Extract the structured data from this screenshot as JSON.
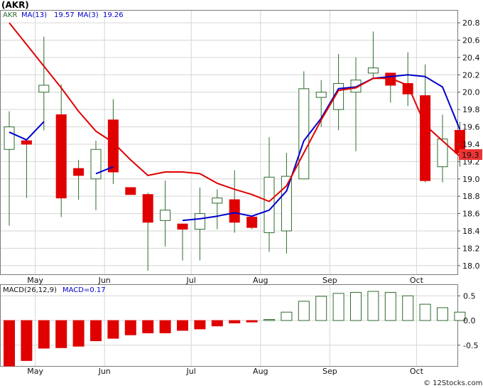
{
  "chart_data": {
    "type": "candlestick",
    "ticker_label": "(AKR)",
    "legend": {
      "ticker": "AKR",
      "ma_long_label": "MA(13)",
      "ma_long_value": "19.57",
      "ma_short_label": "MA(3)",
      "ma_short_value": "19.26"
    },
    "colors": {
      "up_fill": "#ffffff",
      "up_border": "#2e6b2e",
      "down_fill": "#e00000",
      "wick": "#2e6b2e",
      "ma_long": "#0000cc",
      "ma_short": "#e00000",
      "macd_pos_border": "#2e6b2e",
      "macd_neg_fill": "#e00000",
      "grid": "#d6d6d6",
      "panel_bg": "#ffffff",
      "current_price_box": "#ee3333"
    },
    "price_axis": {
      "ylim": [
        17.9,
        20.94
      ],
      "ticks": [
        "20.8",
        "20.6",
        "20.4",
        "20.2",
        "20.0",
        "19.8",
        "19.6",
        "19.4",
        "19.2",
        "19.0",
        "18.8",
        "18.6",
        "18.4",
        "18.2",
        "18.0"
      ],
      "current_price": "19.3"
    },
    "months": [
      "May",
      "Jun",
      "Jul",
      "Aug",
      "Sep",
      "Oct"
    ],
    "month_positions": [
      1.5,
      5.5,
      10.5,
      14.5,
      18.5,
      23.5
    ],
    "candles": [
      {
        "o": 19.34,
        "h": 19.78,
        "l": 18.46,
        "c": 19.6
      },
      {
        "o": 19.44,
        "h": 19.44,
        "l": 18.78,
        "c": 19.4
      },
      {
        "o": 20.0,
        "h": 20.64,
        "l": 19.56,
        "c": 20.08
      },
      {
        "o": 19.74,
        "h": 20.09,
        "l": 18.56,
        "c": 18.78
      },
      {
        "o": 19.12,
        "h": 19.22,
        "l": 18.76,
        "c": 19.04
      },
      {
        "o": 19.0,
        "h": 19.44,
        "l": 18.64,
        "c": 19.34
      },
      {
        "o": 19.68,
        "h": 19.92,
        "l": 18.94,
        "c": 19.08
      },
      {
        "o": 18.9,
        "h": 18.9,
        "l": 18.82,
        "c": 18.82
      },
      {
        "o": 18.82,
        "h": 18.84,
        "l": 17.94,
        "c": 18.5
      },
      {
        "o": 18.52,
        "h": 18.98,
        "l": 18.22,
        "c": 18.64
      },
      {
        "o": 18.48,
        "h": 18.48,
        "l": 18.06,
        "c": 18.42
      },
      {
        "o": 18.42,
        "h": 18.9,
        "l": 18.06,
        "c": 18.6
      },
      {
        "o": 18.72,
        "h": 18.88,
        "l": 18.42,
        "c": 18.78
      },
      {
        "o": 18.76,
        "h": 19.1,
        "l": 18.38,
        "c": 18.5
      },
      {
        "o": 18.56,
        "h": 18.56,
        "l": 18.42,
        "c": 18.44
      },
      {
        "o": 18.38,
        "h": 19.48,
        "l": 18.16,
        "c": 19.02
      },
      {
        "o": 18.4,
        "h": 19.3,
        "l": 18.14,
        "c": 19.03
      },
      {
        "o": 19.0,
        "h": 20.24,
        "l": 19.0,
        "c": 20.04
      },
      {
        "o": 19.94,
        "h": 20.14,
        "l": 19.6,
        "c": 20.0
      },
      {
        "o": 19.8,
        "h": 20.44,
        "l": 19.56,
        "c": 20.1
      },
      {
        "o": 20.0,
        "h": 20.4,
        "l": 19.32,
        "c": 20.14
      },
      {
        "o": 20.22,
        "h": 20.7,
        "l": 20.16,
        "c": 20.28
      },
      {
        "o": 20.22,
        "h": 20.22,
        "l": 19.88,
        "c": 20.08
      },
      {
        "o": 20.1,
        "h": 20.46,
        "l": 19.84,
        "c": 19.98
      },
      {
        "o": 19.96,
        "h": 20.32,
        "l": 18.96,
        "c": 18.98
      },
      {
        "o": 19.14,
        "h": 19.74,
        "l": 18.96,
        "c": 19.46
      },
      {
        "o": 19.56,
        "h": 19.66,
        "l": 19.14,
        "c": 19.3
      }
    ],
    "ma_short": [
      [
        0,
        20.8
      ],
      [
        1,
        20.55
      ],
      [
        2,
        20.3
      ],
      [
        3,
        20.05
      ],
      [
        4,
        19.78
      ],
      [
        5,
        19.55
      ],
      [
        6,
        19.42
      ],
      [
        7,
        19.22
      ],
      [
        8,
        19.04
      ],
      [
        9,
        19.08
      ],
      [
        10,
        19.08
      ],
      [
        11,
        19.06
      ],
      [
        12,
        18.95
      ],
      [
        13,
        18.88
      ],
      [
        14,
        18.82
      ],
      [
        15,
        18.74
      ],
      [
        16,
        18.92
      ],
      [
        17,
        19.3
      ],
      [
        18,
        19.68
      ],
      [
        19,
        20.02
      ],
      [
        20,
        20.05
      ],
      [
        21,
        20.16
      ],
      [
        22,
        20.16
      ],
      [
        23,
        20.08
      ],
      [
        24,
        19.62
      ],
      [
        25,
        19.44
      ],
      [
        26,
        19.26
      ]
    ],
    "ma_long": [
      [
        0,
        19.54
      ],
      [
        1,
        19.45
      ],
      [
        2,
        19.66
      ],
      [
        5,
        19.06
      ],
      [
        6,
        19.14
      ],
      [
        10,
        18.52
      ],
      [
        11,
        18.54
      ],
      [
        12,
        18.57
      ],
      [
        13,
        18.61
      ],
      [
        14,
        18.57
      ],
      [
        15,
        18.64
      ],
      [
        16,
        18.86
      ],
      [
        17,
        19.44
      ],
      [
        18,
        19.7
      ],
      [
        19,
        20.04
      ],
      [
        20,
        20.06
      ],
      [
        21,
        20.16
      ],
      [
        22,
        20.18
      ],
      [
        23,
        20.2
      ],
      [
        24,
        20.18
      ],
      [
        25,
        20.06
      ],
      [
        26,
        19.57
      ]
    ],
    "macd": {
      "label": "MACD(26,12,9)",
      "value_label": "MACD=0.17",
      "ylim": [
        -0.92,
        0.72
      ],
      "ticks": [
        "0.5",
        "0.0",
        "-0.5"
      ],
      "values": [
        -1.02,
        -0.81,
        -0.56,
        -0.55,
        -0.52,
        -0.41,
        -0.36,
        -0.29,
        -0.25,
        -0.25,
        -0.2,
        -0.17,
        -0.11,
        -0.05,
        -0.03,
        0.02,
        0.17,
        0.39,
        0.49,
        0.55,
        0.57,
        0.59,
        0.57,
        0.5,
        0.33,
        0.26,
        0.17
      ]
    }
  },
  "credit": "© 12Stocks.com"
}
